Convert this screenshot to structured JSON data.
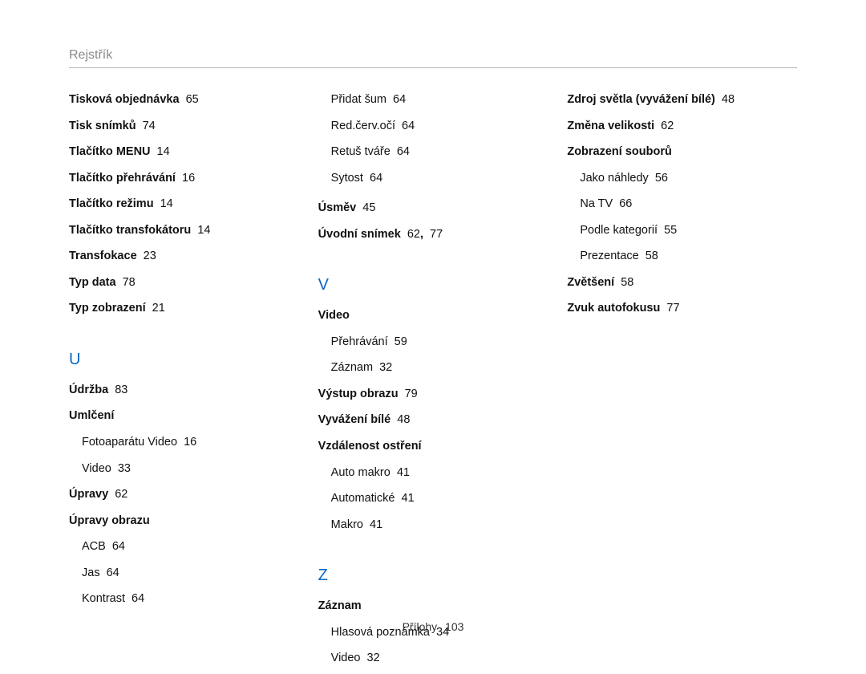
{
  "header": "Rejstřík",
  "footer": {
    "label": "Přílohy",
    "page": "103"
  },
  "col1": {
    "e1": {
      "t": "Tisková objednávka",
      "p": "65"
    },
    "e2": {
      "t": "Tisk snímků",
      "p": "74"
    },
    "e3": {
      "t": "Tlačítko MENU",
      "p": "14"
    },
    "e4": {
      "t": "Tlačítko přehrávání",
      "p": "16"
    },
    "e5": {
      "t": "Tlačítko režimu",
      "p": "14"
    },
    "e6": {
      "t": "Tlačítko transfokátoru",
      "p": "14"
    },
    "e7": {
      "t": "Transfokace",
      "p": "23"
    },
    "e8": {
      "t": "Typ data",
      "p": "78"
    },
    "e9": {
      "t": "Typ zobrazení",
      "p": "21"
    },
    "letterU": "U",
    "u1": {
      "t": "Údržba",
      "p": "83"
    },
    "u2": {
      "t": "Umlčení"
    },
    "u2a": {
      "t": "Fotoaparátu Video",
      "p": "16"
    },
    "u2b": {
      "t": "Video",
      "p": "33"
    },
    "u3": {
      "t": "Úpravy",
      "p": "62"
    },
    "u4": {
      "t": "Úpravy obrazu"
    },
    "u4a": {
      "t": "ACB",
      "p": "64"
    },
    "u4b": {
      "t": "Jas",
      "p": "64"
    },
    "u4c": {
      "t": "Kontrast",
      "p": "64"
    }
  },
  "col2": {
    "c1": {
      "t": "Přidat šum",
      "p": "64"
    },
    "c2": {
      "t": "Red.červ.očí",
      "p": "64"
    },
    "c3": {
      "t": "Retuš tváře",
      "p": "64"
    },
    "c4": {
      "t": "Sytost",
      "p": "64"
    },
    "c5": {
      "t": "Úsměv",
      "p": "45"
    },
    "c6": {
      "t": "Úvodní snímek",
      "p": "62",
      "p2": "77"
    },
    "letterV": "V",
    "v1": {
      "t": "Video"
    },
    "v1a": {
      "t": "Přehrávání",
      "p": "59"
    },
    "v1b": {
      "t": "Záznam",
      "p": "32"
    },
    "v2": {
      "t": "Výstup obrazu",
      "p": "79"
    },
    "v3": {
      "t": "Vyvážení bílé",
      "p": "48"
    },
    "v4": {
      "t": "Vzdálenost ostření"
    },
    "v4a": {
      "t": "Auto makro",
      "p": "41"
    },
    "v4b": {
      "t": "Automatické",
      "p": "41"
    },
    "v4c": {
      "t": "Makro",
      "p": "41"
    },
    "letterZ": "Z",
    "z1": {
      "t": "Záznam"
    },
    "z1a": {
      "t": "Hlasová poznámka",
      "p": "34"
    },
    "z1b": {
      "t": "Video",
      "p": "32"
    }
  },
  "col3": {
    "d1": {
      "t": "Zdroj světla (vyvážení bílé)",
      "p": "48"
    },
    "d2": {
      "t": "Změna velikosti",
      "p": "62"
    },
    "d3": {
      "t": "Zobrazení souborů"
    },
    "d3a": {
      "t": "Jako náhledy",
      "p": "56"
    },
    "d3b": {
      "t": "Na TV",
      "p": "66"
    },
    "d3c": {
      "t": "Podle kategorií",
      "p": "55"
    },
    "d3d": {
      "t": "Prezentace",
      "p": "58"
    },
    "d4": {
      "t": "Zvětšení",
      "p": "58"
    },
    "d5": {
      "t": "Zvuk autofokusu",
      "p": "77"
    }
  }
}
